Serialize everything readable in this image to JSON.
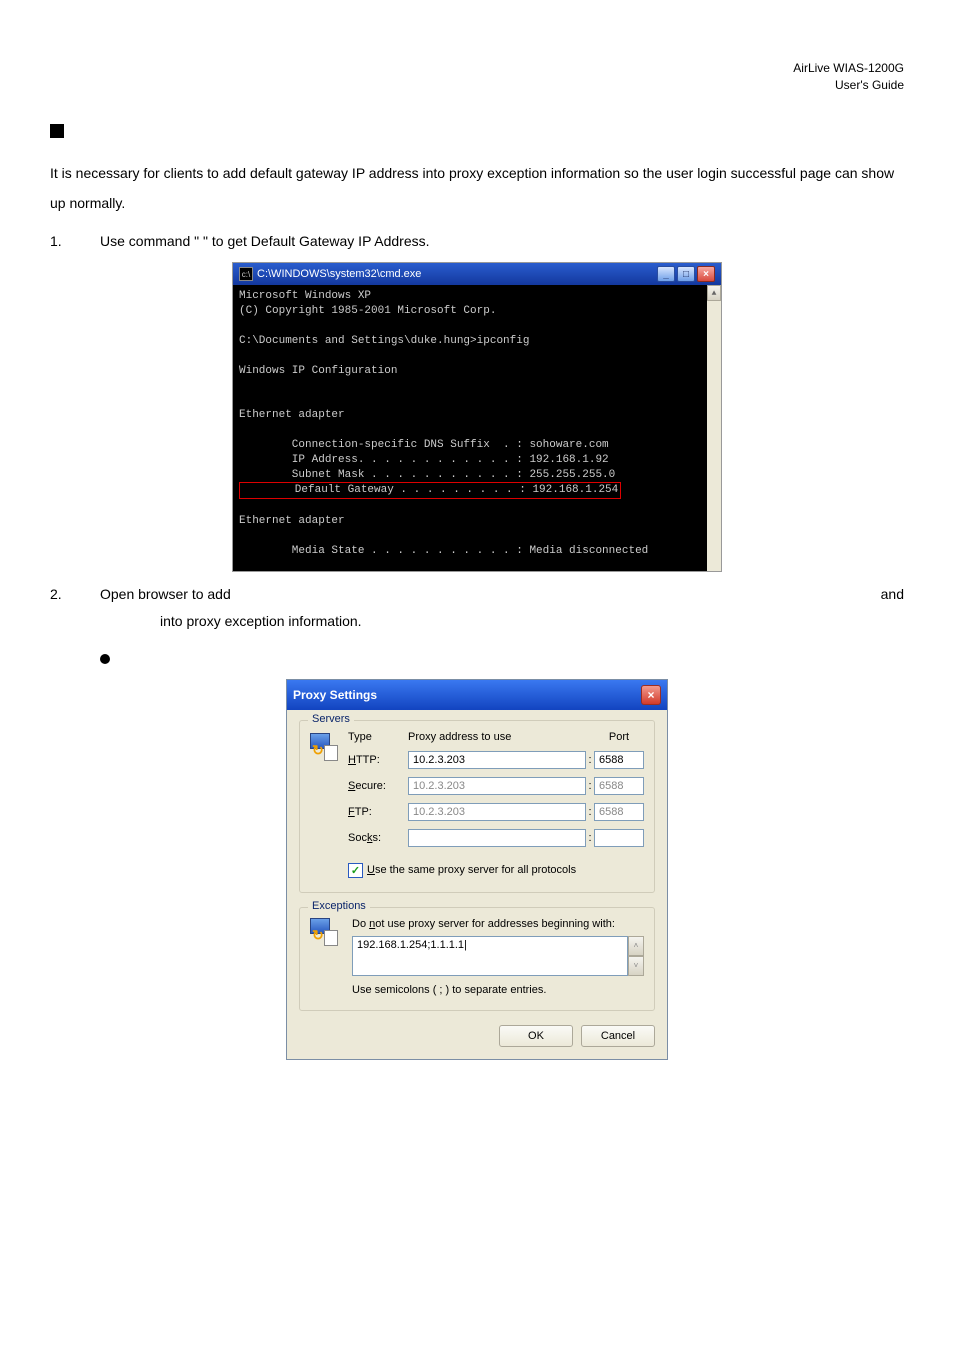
{
  "header": {
    "line1": "AirLive WIAS-1200G",
    "line2": "User's Guide"
  },
  "intro_text": "It is necessary for clients to add default gateway IP address into proxy exception information so the user login successful page can show up normally.",
  "step1": {
    "num": "1.",
    "pre": "Use command \"",
    "post": "\" to get Default Gateway IP Address."
  },
  "terminal": {
    "title": "C:\\WINDOWS\\system32\\cmd.exe",
    "line1": "Microsoft Windows XP",
    "line2": "(C) Copyright 1985-2001 Microsoft Corp.",
    "line3": "C:\\Documents and Settings\\duke.hung>ipconfig",
    "line4": "Windows IP Configuration",
    "line5": "Ethernet adapter",
    "line6": "        Connection-specific DNS Suffix  . : sohoware.com",
    "line7": "        IP Address. . . . . . . . . . . . : 192.168.1.92",
    "line8": "        Subnet Mask . . . . . . . . . . . : 255.255.255.0",
    "line9": "        Default Gateway . . . . . . . . . : 192.168.1.254",
    "line10": "Ethernet adapter",
    "line11": "        Media State . . . . . . . . . . . : Media disconnected",
    "btn_min": "_",
    "btn_max": "□",
    "btn_close": "×",
    "scroll_up": "▲"
  },
  "step2": {
    "num": "2.",
    "pre": "Open browser to add",
    "mid": "and",
    "post": " into proxy exception information."
  },
  "proxy": {
    "title": "Proxy Settings",
    "close": "×",
    "servers_legend": "Servers",
    "hd_type": "Type",
    "hd_addr": "Proxy address to use",
    "hd_port": "Port",
    "rows": [
      {
        "label_pre": "H",
        "label_rest": "TTP:",
        "addr": "10.2.3.203",
        "port": "6588",
        "disabled": false
      },
      {
        "label_pre": "S",
        "label_rest": "ecure:",
        "addr": "10.2.3.203",
        "port": "6588",
        "disabled": true
      },
      {
        "label_pre": "F",
        "label_rest": "TP:",
        "addr": "10.2.3.203",
        "port": "6588",
        "disabled": true
      },
      {
        "label_pre": "",
        "label_rest": "Soc",
        "label_u": "k",
        "label_end": "s:",
        "addr": "",
        "port": "",
        "disabled": false
      }
    ],
    "same_proxy_pre": "U",
    "same_proxy_rest": "se the same proxy server for all protocols",
    "exceptions_legend": "Exceptions",
    "exc_text_pre": "Do ",
    "exc_text_u": "n",
    "exc_text_rest": "ot use proxy server for addresses beginning with:",
    "exc_value": "192.168.1.254;1.1.1.1|",
    "exc_note": "Use semicolons ( ; ) to separate entries.",
    "ok": "OK",
    "cancel": "Cancel",
    "spin_up": "˄",
    "spin_down": "˅"
  }
}
